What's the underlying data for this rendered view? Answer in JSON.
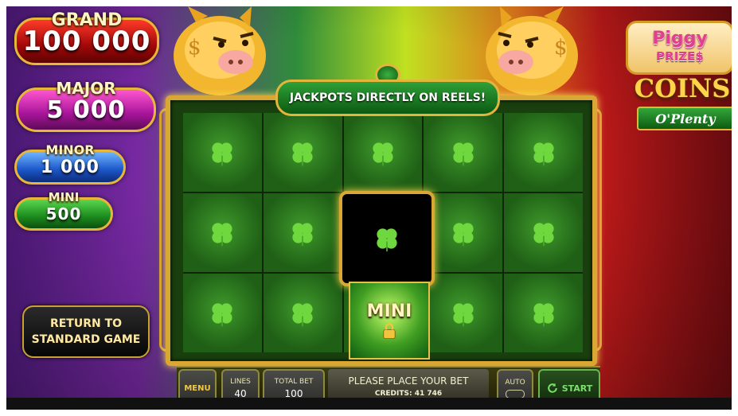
{
  "jackpots": {
    "grand": {
      "label": "GRAND",
      "value": "100 000"
    },
    "major": {
      "label": "MAJOR",
      "value": "5 000"
    },
    "minor": {
      "label": "MINOR",
      "value": "1 000"
    },
    "mini": {
      "label": "MINI",
      "value": "500"
    }
  },
  "return_button": {
    "line1": "RETURN TO",
    "line2": "STANDARD GAME"
  },
  "banner": "JACKPOTS DIRECTLY ON REELS!",
  "logo": {
    "piggy": "Piggy",
    "prizes": "PRIZE$",
    "coins": "COINS",
    "oplenty": "O'Plenty"
  },
  "reel_symbol_mini": "MINI",
  "bottom_bar": {
    "menu": "MENU",
    "lines_label": "LINES",
    "lines_value": "40",
    "total_bet_label": "TOTAL BET",
    "total_bet_value": "100",
    "message": "PLEASE PLACE YOUR BET",
    "credits": "CREDITS: 41 746",
    "auto_label": "AUTO",
    "start_label": "START"
  },
  "colors": {
    "clover": "#6fd83f",
    "gold": "#e2b53c",
    "grand": "#c20f0f",
    "major": "#b3179f",
    "minor": "#1b55c8",
    "mini": "#1c8a1d"
  }
}
